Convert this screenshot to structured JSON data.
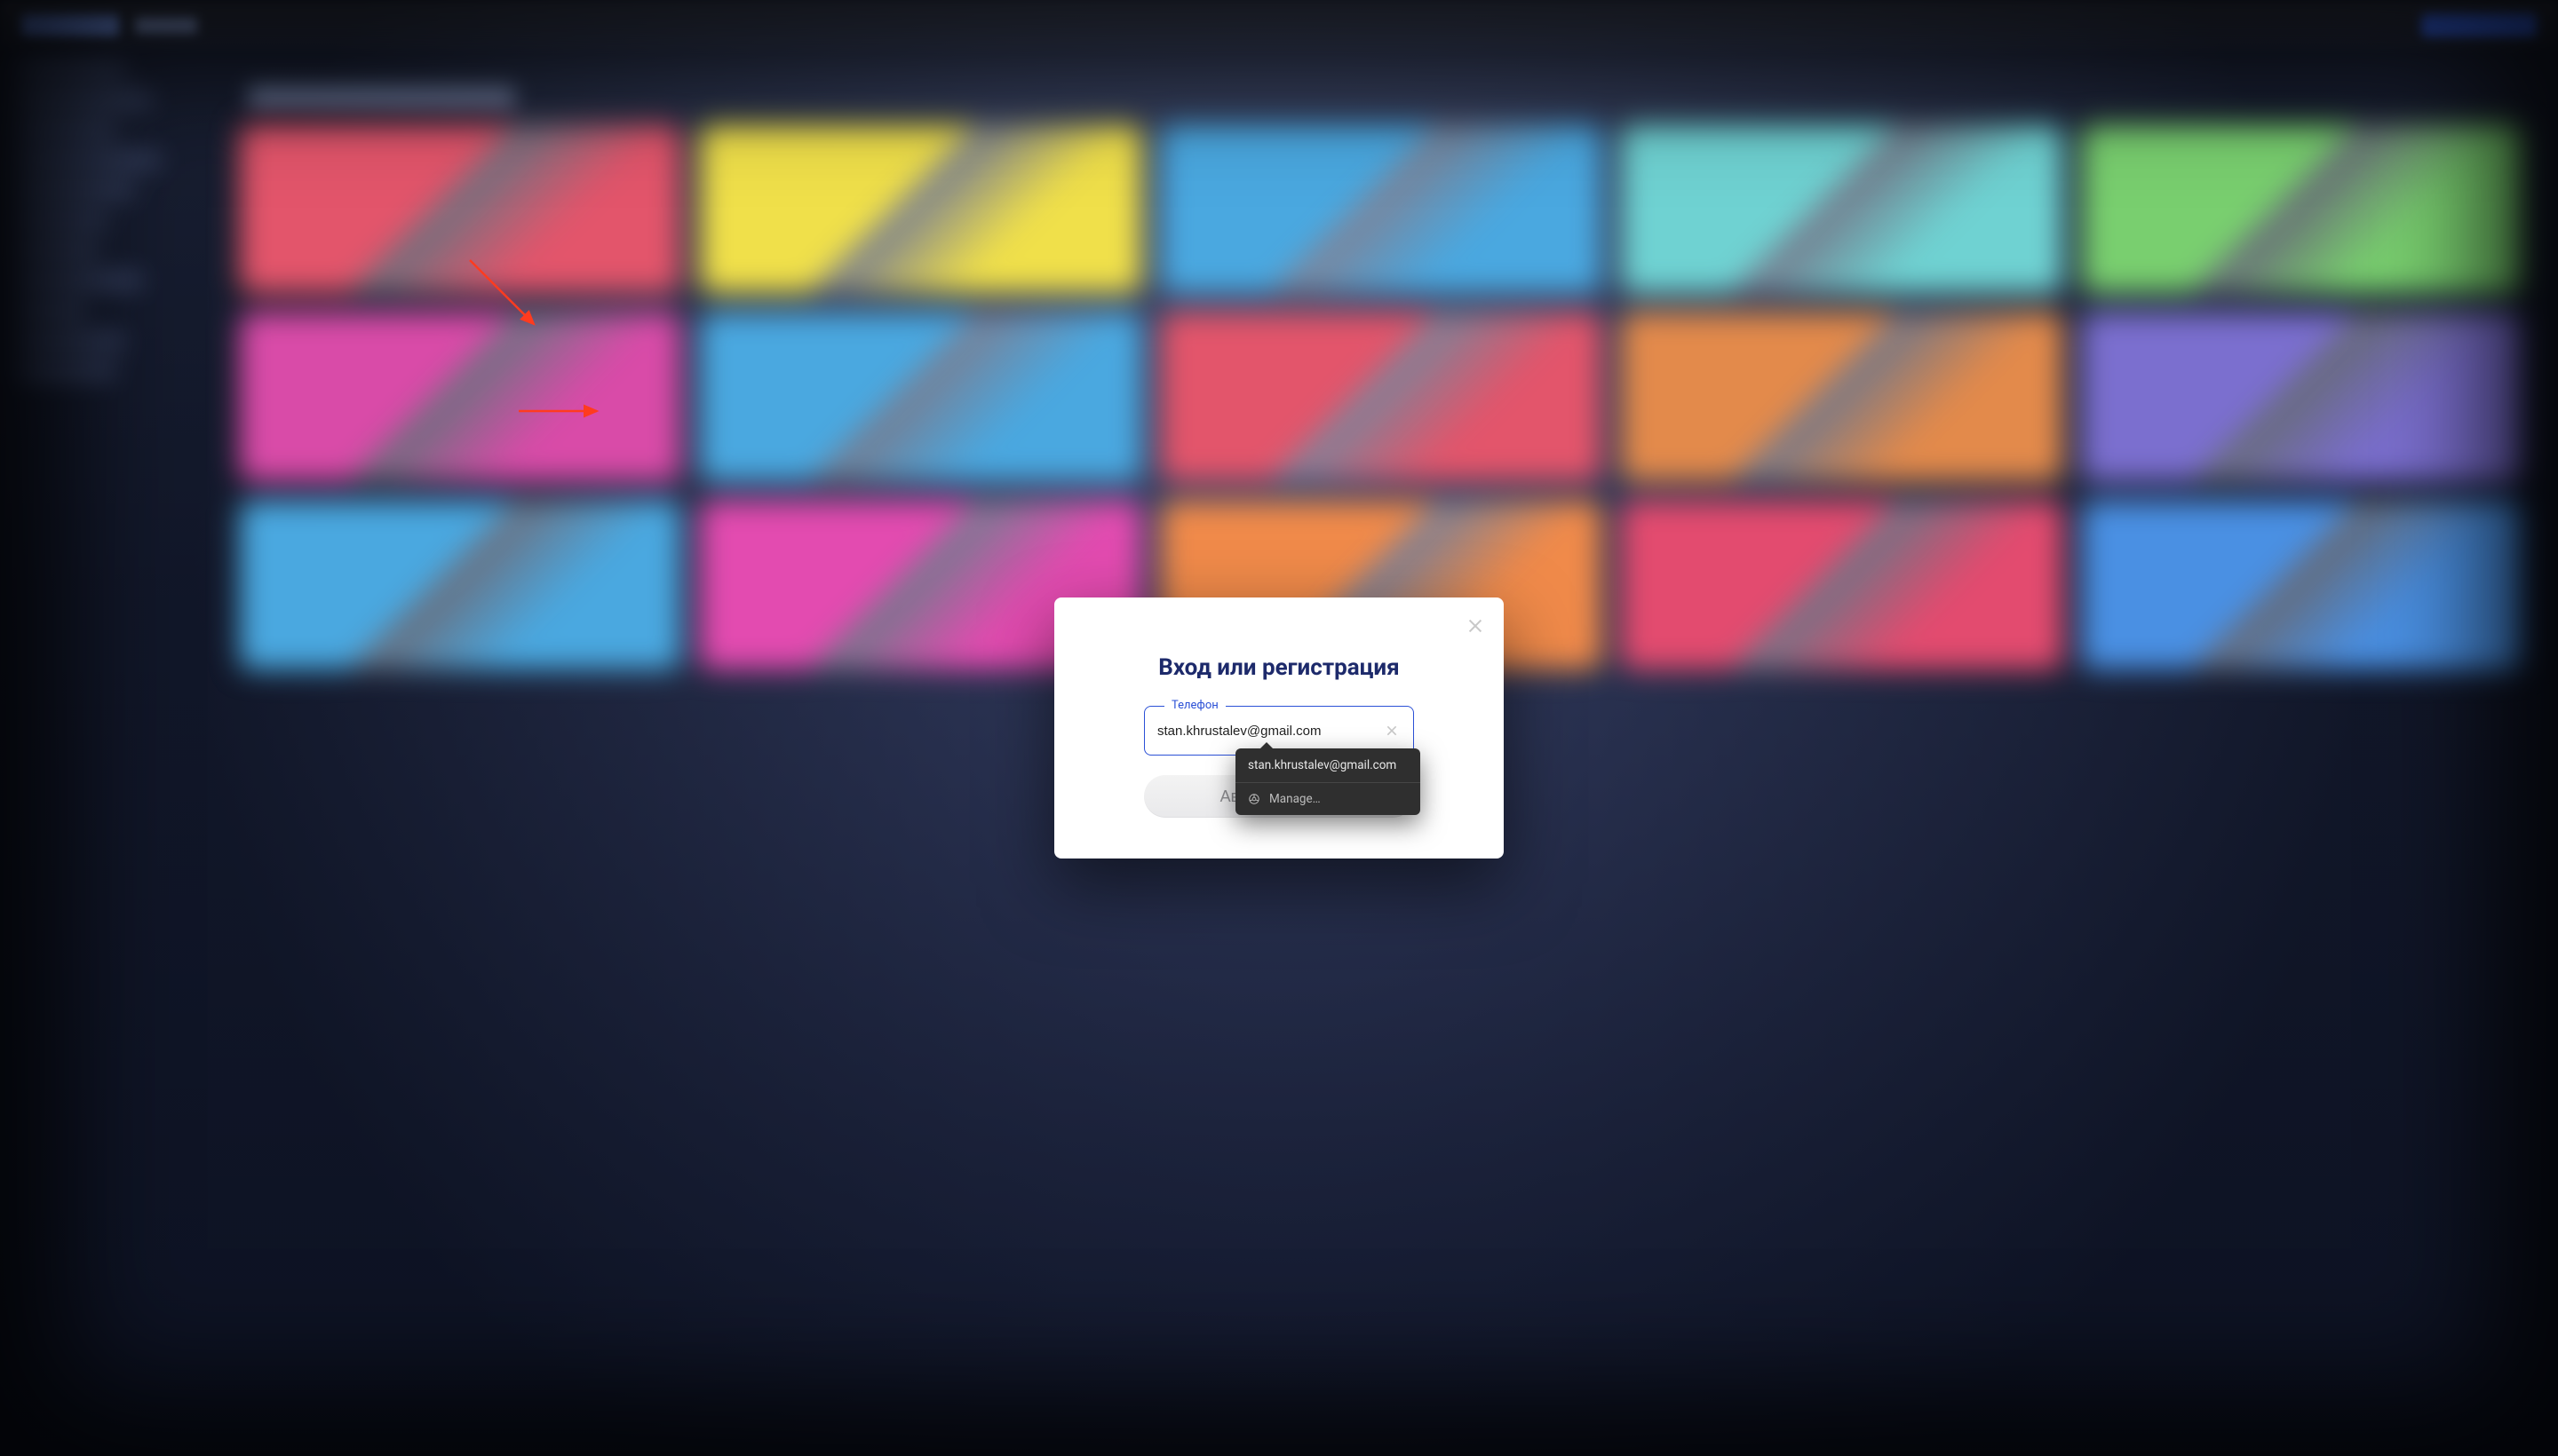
{
  "modal": {
    "title": "Вход или регистрация",
    "phone_label": "Телефон",
    "phone_value": "stan.khrustalev@gmail.com",
    "submit_label": "Авторизоваться"
  },
  "autofill": {
    "suggestion": "stan.khrustalev@gmail.com",
    "manage_label": "Manage…"
  },
  "bg": {
    "cards": [
      "#e3556b",
      "#f0e04a",
      "#4aa8e0",
      "#6fd2d2",
      "#79cf6f",
      "#d94ba8",
      "#4aa8e0",
      "#e3556b",
      "#e38a4b",
      "#7b6fcf",
      "#4aa8e0",
      "#e34bb0",
      "#f08a4a",
      "#e34b6f",
      "#4a90e3"
    ]
  }
}
